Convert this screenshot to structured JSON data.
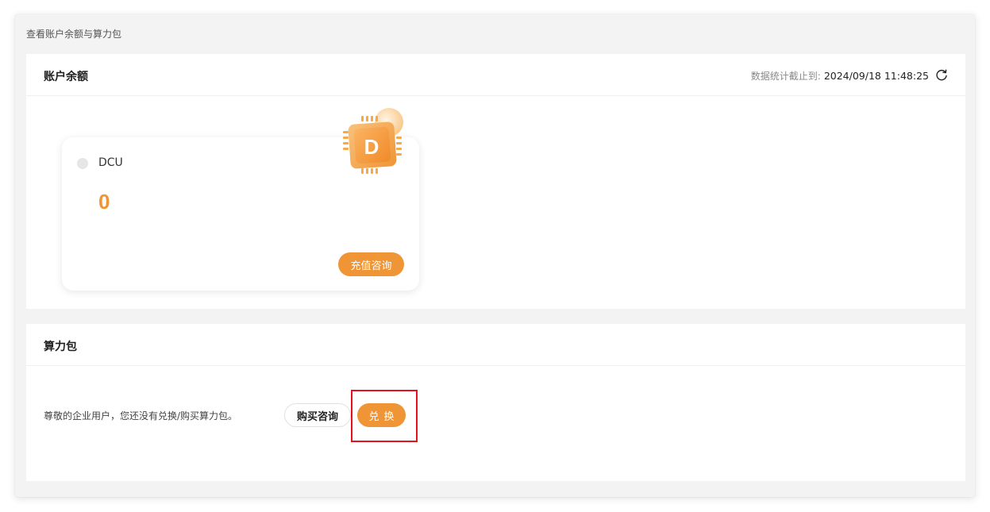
{
  "breadcrumb": "查看账户余额与算力包",
  "balance": {
    "title": "账户余额",
    "stat_label": "数据统计截止到:",
    "stat_time": "2024/09/18 11:48:25",
    "dcu_label": "DCU",
    "dcu_value": "0",
    "recharge_label": "充值咨询",
    "chip_letter": "D"
  },
  "package": {
    "title": "算力包",
    "message": "尊敬的企业用户，您还没有兑换/购买算力包。",
    "buy_label": "购买咨询",
    "exchange_label": "兑换"
  },
  "colors": {
    "accent": "#ef9535",
    "highlight": "#e0141a"
  },
  "icons": [
    "refresh-icon",
    "chip-icon"
  ]
}
